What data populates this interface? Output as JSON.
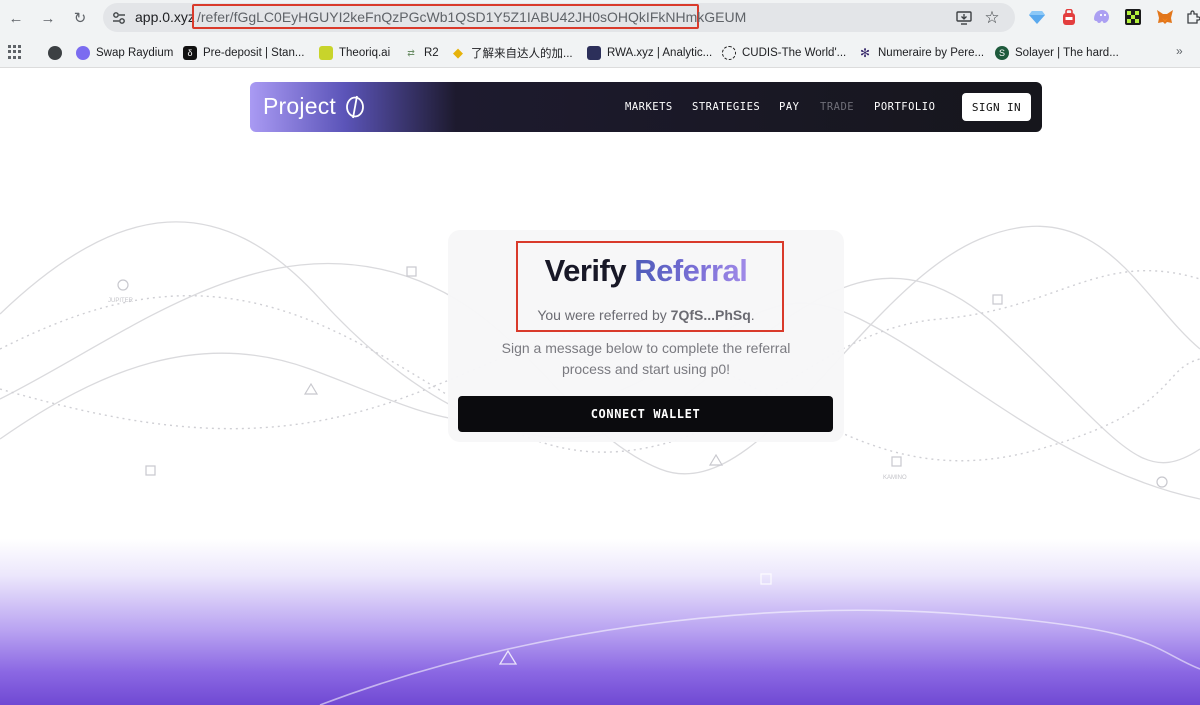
{
  "browser": {
    "url_host": "app.0.xyz",
    "url_path": "/refer/fGgLC0EyHGUYI2keFnQzPGcWb1QSD1Y5Z1IABU42JH0sOHQkIFkNHmkGEUM",
    "bookmarks": [
      {
        "label": "Swap Raydium",
        "icon": "raydium-icon",
        "color": "#6b6bd6"
      },
      {
        "label": "Pre-deposit | Stan...",
        "icon": "stan-icon",
        "color": "#111111"
      },
      {
        "label": "Theoriq.ai",
        "icon": "theoriq-icon",
        "color": "#c8d42b"
      },
      {
        "label": "R2",
        "icon": "r2-icon",
        "color": "#8fb08a"
      },
      {
        "label": "了解来自达人的加...",
        "icon": "binance-icon",
        "color": "#e6b20b"
      },
      {
        "label": "RWA.xyz | Analytic...",
        "icon": "rwa-icon",
        "color": "#2c2f5a"
      },
      {
        "label": "CUDIS-The World'...",
        "icon": "cudis-icon",
        "color": "#222222"
      },
      {
        "label": "Numeraire by Pere...",
        "icon": "numeraire-icon",
        "color": "#3b2d6e"
      },
      {
        "label": "Solayer | The hard...",
        "icon": "solayer-icon",
        "color": "#1e5a3c"
      }
    ],
    "more": "»"
  },
  "nav": {
    "logo": "Project",
    "links": [
      "MARKETS",
      "STRATEGIES",
      "PAY",
      "TRADE",
      "PORTFOLIO"
    ],
    "active_disabled": "TRADE",
    "sign_in": "SIGN IN"
  },
  "card": {
    "title_part1": "Verify",
    "title_part2": "Referral",
    "referred_prefix": "You were referred by",
    "referrer": "7QfS...PhSq",
    "referred_suffix": ".",
    "description": "Sign a message below to complete the referral process and start using p0!",
    "button": "CONNECT WALLET"
  },
  "background_labels": {
    "jupiter": "JUPITER",
    "kamino": "KAMINO"
  },
  "colors": {
    "accent_purple": "#7a6fd6",
    "highlight_red": "#d93a2b",
    "button_dark": "#0b0b0e"
  }
}
